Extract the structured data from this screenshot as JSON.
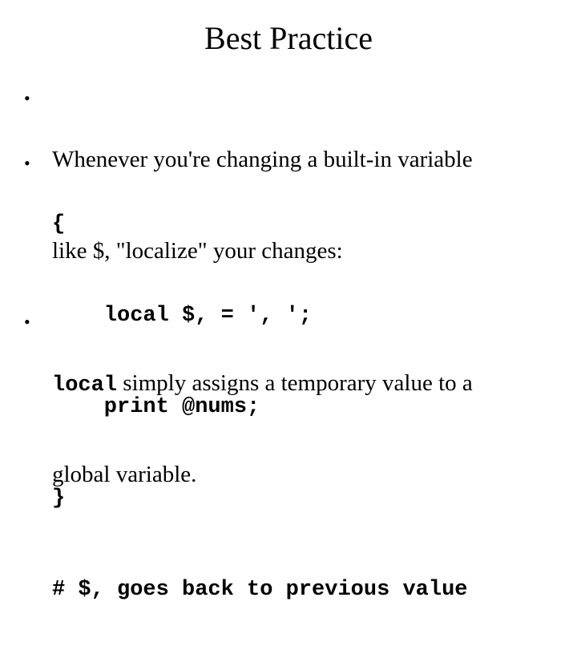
{
  "slide": {
    "title": "Best Practice",
    "bullets": [
      {
        "marker": "•",
        "lines": [
          "Whenever you're changing a built-in variable",
          "like $, \"localize\" your changes:"
        ]
      },
      {
        "marker": "•",
        "code_lines": [
          "{",
          "    local $, = ', ';",
          "    print @nums;",
          "}",
          "# $, goes back to previous value"
        ]
      },
      {
        "marker": "•",
        "code_prefix": "local",
        "text_after_prefix": " simply assigns a temporary value to a",
        "line2": "global variable."
      }
    ]
  }
}
